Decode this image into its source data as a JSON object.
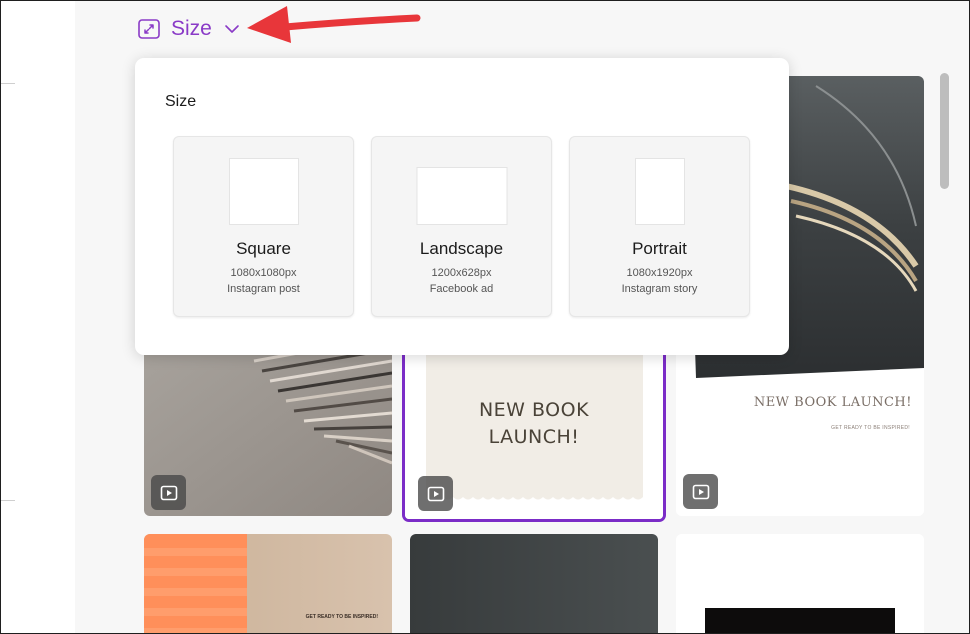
{
  "toolbar": {
    "size_label": "Size",
    "icons": {
      "expand": "expand-icon",
      "dropdown": "chevron-down-icon"
    }
  },
  "popover": {
    "title": "Size",
    "options": [
      {
        "name": "Square",
        "dimensions": "1080x1080px",
        "use": "Instagram post"
      },
      {
        "name": "Landscape",
        "dimensions": "1200x628px",
        "use": "Facebook ad"
      },
      {
        "name": "Portrait",
        "dimensions": "1080x1920px",
        "use": "Instagram story"
      }
    ]
  },
  "templates": {
    "card2_title": "NEW BOOK\nLAUNCH!",
    "card3_title": "NEW BOOK LAUNCH!",
    "card3_subtitle": "GET READY TO BE INSPIRED!",
    "card4_text": "GET READY TO BE INSPIRED!"
  },
  "colors": {
    "accent": "#8a3ac7",
    "annotation_arrow": "#e8363a",
    "selected_border": "#7b2cc7"
  }
}
